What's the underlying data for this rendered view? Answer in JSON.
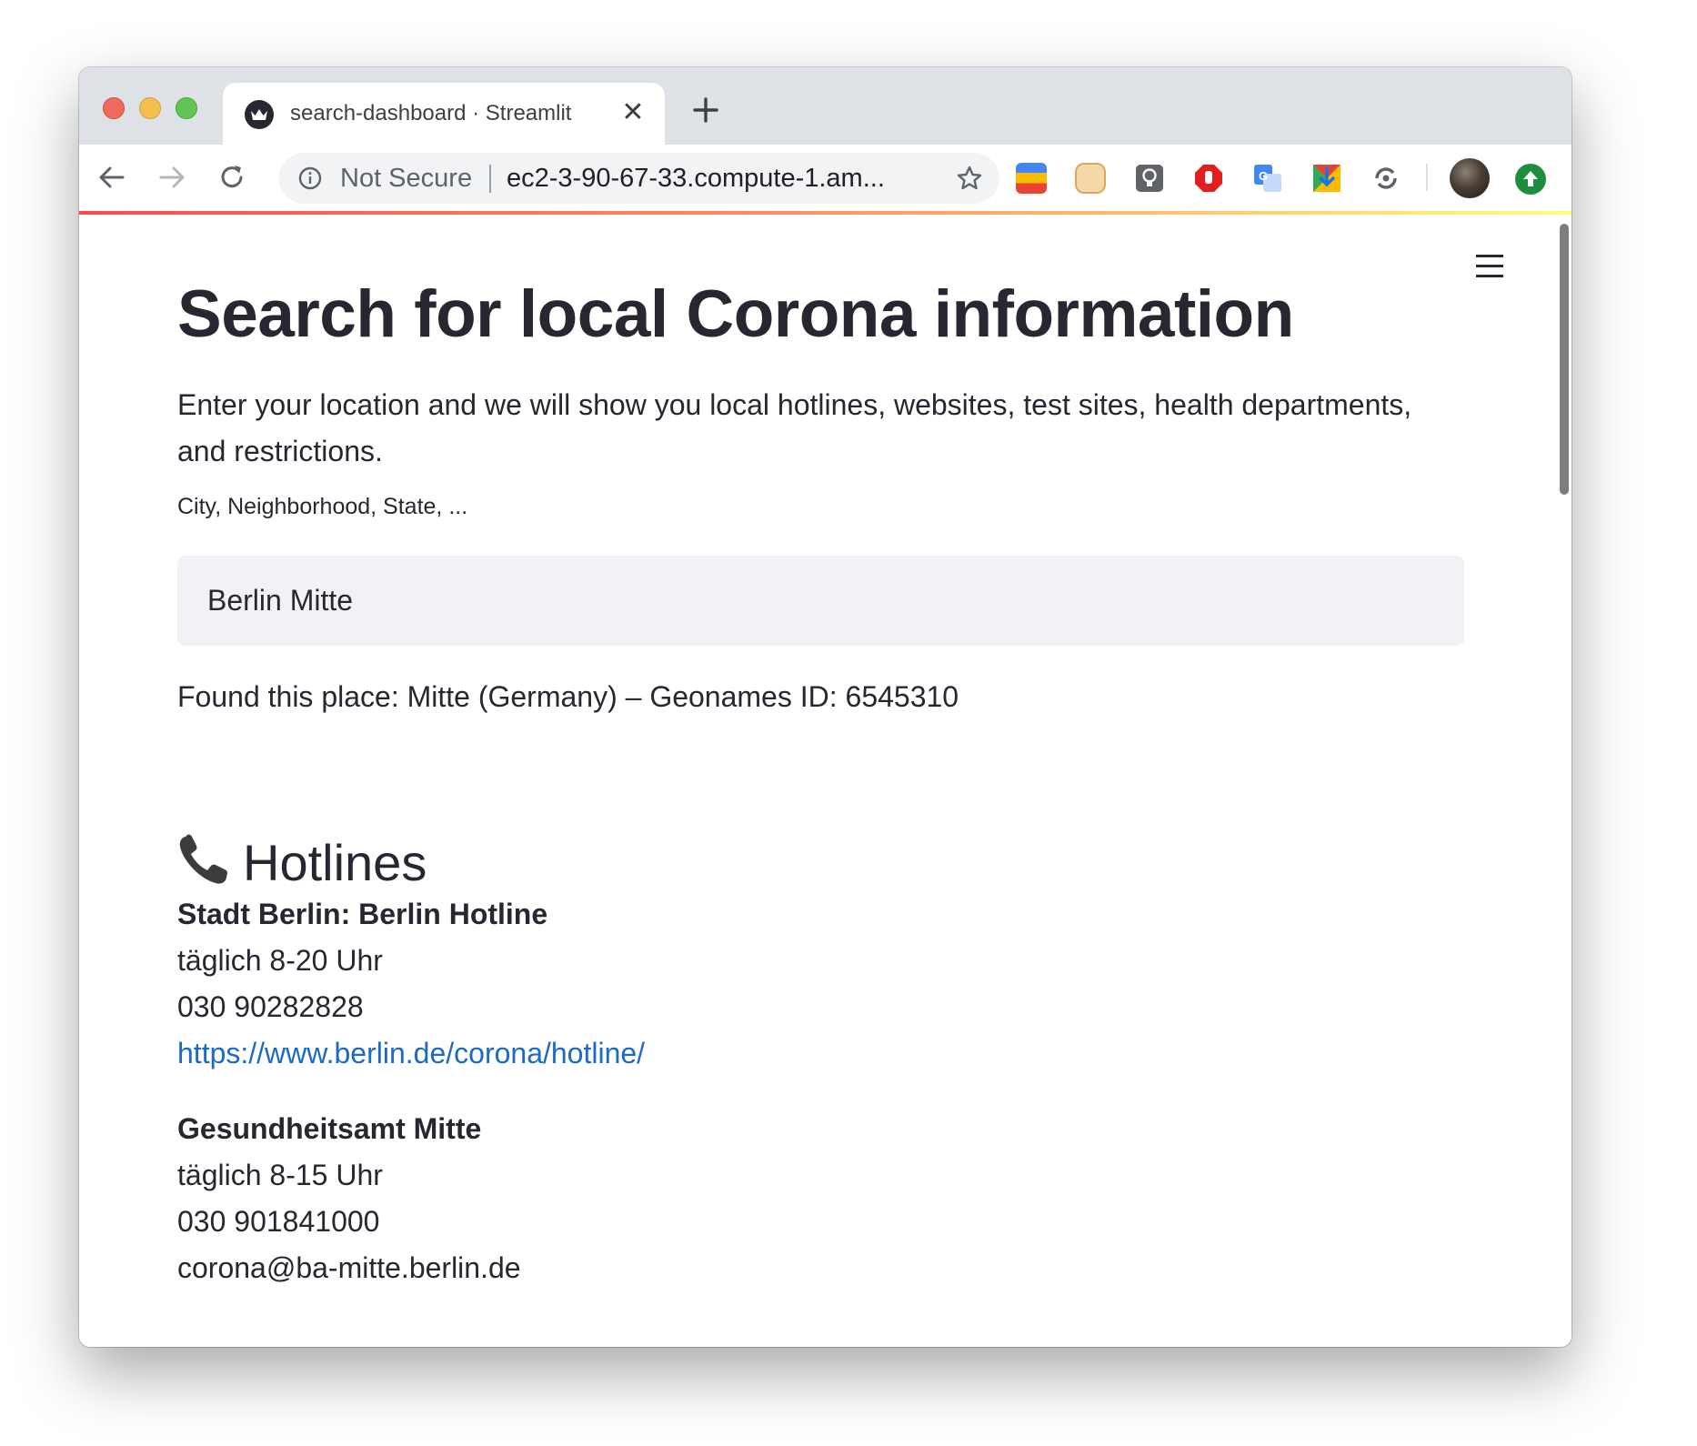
{
  "browser": {
    "tab": {
      "title": "search-dashboard · Streamlit",
      "close_glyph": "✕"
    },
    "omnibox": {
      "security_text": "Not Secure",
      "url": "ec2-3-90-67-33.compute-1.am..."
    },
    "extensions": [
      "google-apps-icon",
      "hamster-extension-icon",
      "lightbulb-extension-icon",
      "adblock-icon",
      "google-translate-icon",
      "download-extension-icon",
      "sync-extension-icon"
    ]
  },
  "app": {
    "title": "Search for local Corona information",
    "intro": "Enter your location and we will show you local hotlines, websites, test sites, health departments, and restrictions.",
    "search": {
      "label": "City, Neighborhood, State, ...",
      "value": "Berlin Mitte"
    },
    "found_text": "Found this place: Mitte (Germany) – Geonames ID: 6545310",
    "hotlines": {
      "heading": "Hotlines",
      "entries": [
        {
          "name": "Stadt Berlin: Berlin Hotline",
          "hours": "täglich 8-20 Uhr",
          "phone": "030 90282828",
          "link": "https://www.berlin.de/corona/hotline/"
        },
        {
          "name": "Gesundheitsamt Mitte",
          "hours": "täglich 8-15 Uhr",
          "phone": "030 901841000",
          "email": "corona@ba-mitte.berlin.de"
        }
      ]
    }
  },
  "colors": {
    "accent": "#ff4b4b",
    "text": "#262730",
    "link": "#1c6ac5",
    "input_bg": "#f0f2f6"
  }
}
